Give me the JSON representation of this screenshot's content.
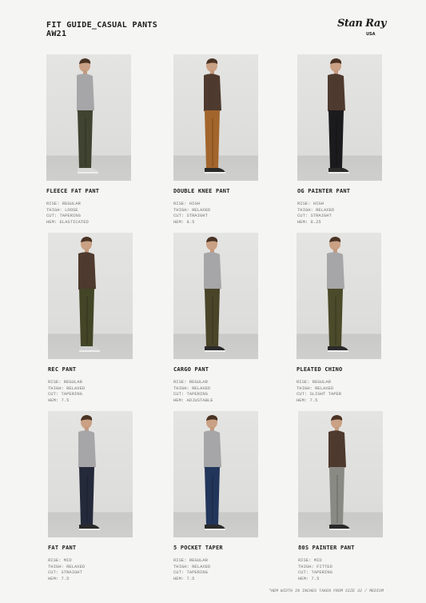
{
  "header": {
    "title_line1": "FIT GUIDE_CASUAL PANTS",
    "title_line2": "AW21"
  },
  "logo": {
    "script": "Stan Ray",
    "sub": "USA"
  },
  "cards": [
    {
      "name": "FLEECE FAT PANT",
      "rise": "RISE: REGULAR",
      "thigh": "THIGH: LOOSE",
      "cut": "CUT: TAPERING",
      "hem": "HEM: ELASTICATED",
      "colors": {
        "top": "#a6a6a8",
        "pant": "#3f4330",
        "shoe": "#d8d8d8"
      }
    },
    {
      "name": "DOUBLE KNEE PANT",
      "rise": "RISE: HIGH",
      "thigh": "THIGH: RELAXED",
      "cut": "CUT: STRAIGHT",
      "hem": "HEM: 8.5",
      "colors": {
        "top": "#4e3a2e",
        "pant": "#a2652c",
        "shoe": "#2a2a2a"
      }
    },
    {
      "name": "OG PAINTER PANT",
      "rise": "RISE: HIGH",
      "thigh": "THIGH: RELAXED",
      "cut": "CUT: STRAIGHT",
      "hem": "HEM: 8.25",
      "colors": {
        "top": "#4e3a2e",
        "pant": "#1b1b1d",
        "shoe": "#2a2a2a"
      }
    },
    {
      "name": "REC PANT",
      "rise": "RISE: REGULAR",
      "thigh": "THIGH: RELAXED",
      "cut": "CUT: TAPERING",
      "hem": "HEM: 7.5",
      "colors": {
        "top": "#4e3a2e",
        "pant": "#434527",
        "shoe": "#d0d0d0"
      }
    },
    {
      "name": "CARGO PANT",
      "rise": "RISE: REGULAR",
      "thigh": "THIGH: RELAXED",
      "cut": "CUT: TAPERING",
      "hem": "HEM: ADJUSTABLE",
      "colors": {
        "top": "#a6a6a8",
        "pant": "#4a4529",
        "shoe": "#2a2a2a"
      }
    },
    {
      "name": "PLEATED CHINO",
      "rise": "RISE: REGULAR",
      "thigh": "THIGH: RELAXED",
      "cut": "CUT: SLIGHT TAPER",
      "hem": "HEM: 7.5",
      "colors": {
        "top": "#a6a6a8",
        "pant": "#4b4a2a",
        "shoe": "#2a2a2a"
      }
    },
    {
      "name": "FAT PANT",
      "rise": "RISE: MID",
      "thigh": "THIGH: RELAXED",
      "cut": "CUT: STRAIGHT",
      "hem": "HEM: 7.5",
      "colors": {
        "top": "#a6a6a8",
        "pant": "#252a3b",
        "shoe": "#2a2a2a"
      }
    },
    {
      "name": "5 POCKET TAPER",
      "rise": "RISE: REGULAR",
      "thigh": "THIGH: RELAXED",
      "cut": "CUT: TAPERING",
      "hem": "HEM: 7.5",
      "colors": {
        "top": "#a6a6a8",
        "pant": "#22355a",
        "shoe": "#2a2a2a"
      }
    },
    {
      "name": "80S PAINTER PANT",
      "rise": "RISE: MID",
      "thigh": "THIGH: FITTED",
      "cut": "CUT: TAPERING",
      "hem": "HEM: 7.5",
      "colors": {
        "top": "#4e3a2e",
        "pant": "#8a8a84",
        "shoe": "#2a2a2a"
      }
    }
  ],
  "footnote": "*HEM WIDTH IN INCHES TAKEN FROM SIZE 32 / MEDIUM"
}
